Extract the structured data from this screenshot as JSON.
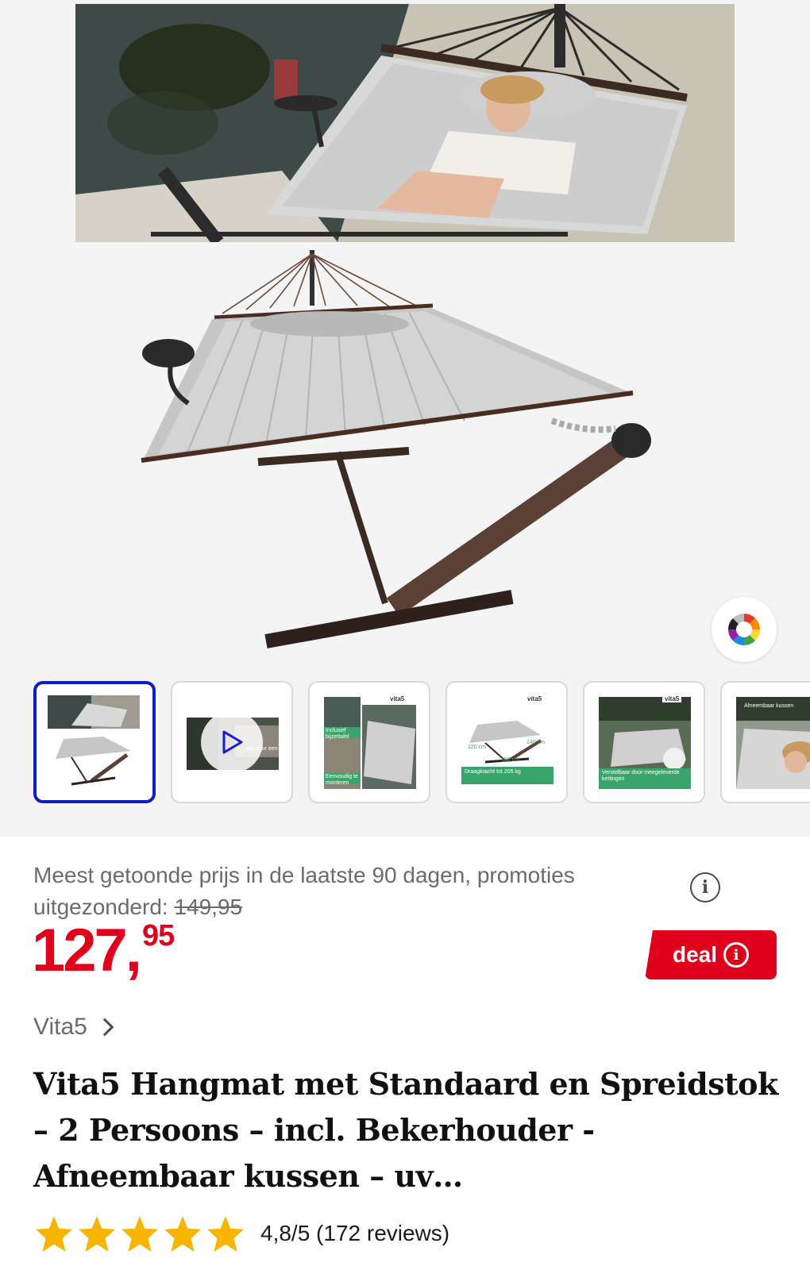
{
  "gallery": {
    "main_image": "hammock-with-stand-photo",
    "color_button_icon": "color-wheel-icon",
    "thumbnails": [
      {
        "type": "image",
        "active": true
      },
      {
        "type": "video",
        "overlay_text": "zon voor een"
      },
      {
        "type": "image",
        "brand": "vita5",
        "text_1": "Inclusief bijzettafel",
        "text_2": "Eenvoudig te monteren"
      },
      {
        "type": "image",
        "brand": "vita5",
        "dim_1": "120 cm",
        "dim_2": "140 cm",
        "dim_3": "100 cm",
        "caption": "Draagkracht tot 205 kg"
      },
      {
        "type": "image",
        "brand": "vita5",
        "caption": "Verstelbaar door meegeleverde kettingen"
      },
      {
        "type": "image",
        "caption": "Afneembaar kussen"
      }
    ]
  },
  "price_block": {
    "lowest_price_label": "Meest getoonde prijs in de laatste 90 dagen, promoties uitgezonderd:",
    "lowest_price_value": "149,95",
    "price_main": "127,",
    "price_cents": "95",
    "deal_label": "deal"
  },
  "product": {
    "brand": "Vita5",
    "title": "Vita5 Hangmat met Standaard en Spreidstok – 2 Persoons – incl. Bekerhouder - Afneembaar kussen – uv…",
    "rating_value": 4.8,
    "rating_text": "4,8/5 (172 reviews)",
    "stars_filled": 5
  },
  "colors": {
    "price_red": "#e0001b",
    "active_thumb_border": "#0a1fbf",
    "star_yellow": "#f7b500"
  }
}
